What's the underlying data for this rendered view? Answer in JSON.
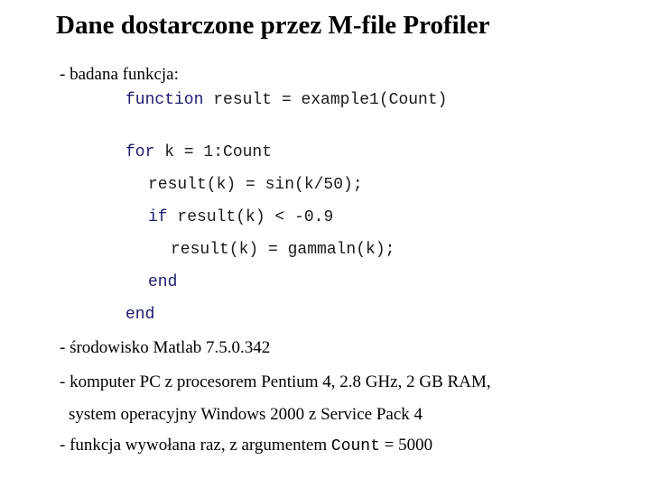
{
  "title": "Dane dostarczone przez M-file Profiler",
  "intro": "- badana funkcja:",
  "code": {
    "line1_kw": "function",
    "line1_rest": " result = example1(Count)",
    "line2_kw": "for",
    "line2_rest": " k = 1:Count",
    "line3": "result(k) = sin(k/50);",
    "line4_kw": "if",
    "line4_rest": " result(k) < -0.9",
    "line5": "result(k) = gammaln(k);",
    "line6_kw": "end",
    "line7_kw": "end"
  },
  "info": {
    "environment": "- środowisko Matlab 7.5.0.342",
    "computer": "- komputer PC z procesorem Pentium 4, 2.8 GHz, 2 GB RAM,",
    "system": "system operacyjny Windows 2000 z Service Pack 4",
    "call_prefix": "- funkcja wywołana raz, z argumentem ",
    "call_arg": "Count",
    "call_suffix": " = 5000"
  },
  "colors": {
    "keyword": "#1c1c6e",
    "text": "#000000"
  }
}
